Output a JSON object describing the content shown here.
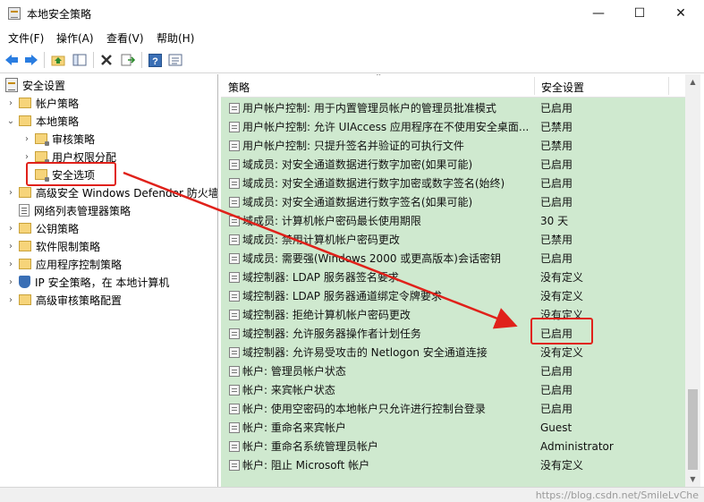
{
  "window": {
    "title": "本地安全策略",
    "minimize": "—",
    "maximize": "☐",
    "close": "✕"
  },
  "menu": [
    "文件(F)",
    "操作(A)",
    "查看(V)",
    "帮助(H)"
  ],
  "toolbar": {
    "icons": [
      "back-arrow-icon",
      "forward-arrow-icon",
      "up-folder-icon",
      "show-hide-tree-icon",
      "delete-icon",
      "export-list-icon",
      "help-icon",
      "properties-icon"
    ]
  },
  "tree": {
    "root": "安全设置",
    "items": [
      {
        "label": "帐户策略",
        "level": 1,
        "expanded": false
      },
      {
        "label": "本地策略",
        "level": 1,
        "expanded": true
      },
      {
        "label": "审核策略",
        "level": 2,
        "expanded": false
      },
      {
        "label": "用户权限分配",
        "level": 2,
        "expanded": false
      },
      {
        "label": "安全选项",
        "level": 2,
        "selected": true
      },
      {
        "label": "高级安全 Windows Defender 防火墙",
        "level": 1,
        "expanded": false
      },
      {
        "label": "网络列表管理器策略",
        "level": 1
      },
      {
        "label": "公钥策略",
        "level": 1,
        "expanded": false
      },
      {
        "label": "软件限制策略",
        "level": 1,
        "expanded": false
      },
      {
        "label": "应用程序控制策略",
        "level": 1,
        "expanded": false
      },
      {
        "label": "IP 安全策略，在 本地计算机",
        "level": 1
      },
      {
        "label": "高级审核策略配置",
        "level": 1,
        "expanded": false
      }
    ]
  },
  "list": {
    "columns": {
      "policy": "策略",
      "setting": "安全设置"
    },
    "rows": [
      {
        "policy": "用户帐户控制: 用于内置管理员帐户的管理员批准模式",
        "setting": "已启用"
      },
      {
        "policy": "用户帐户控制: 允许 UIAccess 应用程序在不使用安全桌面...",
        "setting": "已禁用"
      },
      {
        "policy": "用户帐户控制: 只提升签名并验证的可执行文件",
        "setting": "已禁用"
      },
      {
        "policy": "域成员: 对安全通道数据进行数字加密(如果可能)",
        "setting": "已启用"
      },
      {
        "policy": "域成员: 对安全通道数据进行数字加密或数字签名(始终)",
        "setting": "已启用"
      },
      {
        "policy": "域成员: 对安全通道数据进行数字签名(如果可能)",
        "setting": "已启用"
      },
      {
        "policy": "域成员: 计算机帐户密码最长使用期限",
        "setting": "30 天"
      },
      {
        "policy": "域成员: 禁用计算机帐户密码更改",
        "setting": "已禁用"
      },
      {
        "policy": "域成员: 需要强(Windows 2000 或更高版本)会话密钥",
        "setting": "已启用"
      },
      {
        "policy": "域控制器: LDAP 服务器签名要求",
        "setting": "没有定义"
      },
      {
        "policy": "域控制器: LDAP 服务器通道绑定令牌要求",
        "setting": "没有定义"
      },
      {
        "policy": "域控制器: 拒绝计算机帐户密码更改",
        "setting": "没有定义"
      },
      {
        "policy": "域控制器: 允许服务器操作者计划任务",
        "setting": "已启用"
      },
      {
        "policy": "域控制器: 允许易受攻击的 Netlogon 安全通道连接",
        "setting": "没有定义"
      },
      {
        "policy": "帐户: 管理员帐户状态",
        "setting": "已启用"
      },
      {
        "policy": "帐户: 来宾帐户状态",
        "setting": "已启用"
      },
      {
        "policy": "帐户: 使用空密码的本地帐户只允许进行控制台登录",
        "setting": "已启用"
      },
      {
        "policy": "帐户: 重命名来宾帐户",
        "setting": "Guest"
      },
      {
        "policy": "帐户: 重命名系统管理员帐户",
        "setting": "Administrator"
      },
      {
        "policy": "帐户: 阻止 Microsoft 帐户",
        "setting": "没有定义"
      }
    ]
  },
  "watermark": "https://blog.csdn.net/SmileLvChe",
  "colors": {
    "list_background": "#cfe9cf",
    "annotation_red": "#e0211a"
  }
}
